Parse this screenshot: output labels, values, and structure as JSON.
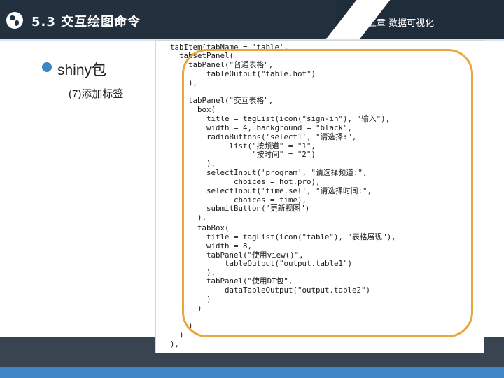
{
  "header": {
    "title": "5.3 交互绘图命令",
    "chapter": "第五章 数据可视化"
  },
  "content": {
    "bullet": "shiny包",
    "subheading": "(7)添加标签"
  },
  "code": {
    "lines": [
      "tabItem(tabName = 'table',",
      "  tabsetPanel(",
      "    tabPanel(\"普通表格\",",
      "        tableOutput(\"table.hot\")",
      "    ),",
      "    tabPanel(\"交互表格\",",
      "      box(",
      "        title = tagList(icon(\"sign-in\"), \"输入\"),",
      "        width = 4, background = \"black\",",
      "        radioButtons('select1', \"请选择:\",",
      "             list(\"按频道\" = \"1\",",
      "                  \"按时间\" = \"2\")",
      "        ),",
      "        selectInput('program', \"请选择频道:\",",
      "              choices = hot.pro),",
      "        selectInput('time.sel', \"请选择时间:\",",
      "              choices = time),",
      "        submitButton(\"更新视图\")",
      "      ),",
      "      tabBox(",
      "        title = tagList(icon(\"table\"), \"表格展现\"),",
      "        width = 8,",
      "        tabPanel(\"使用view()\",",
      "            tableOutput(\"output.table1\")",
      "        ),",
      "        tabPanel(\"使用DT包\",",
      "            dataTableOutput(\"output.table2\")",
      "        )",
      "      )",
      "    )",
      "  )",
      "),"
    ]
  }
}
